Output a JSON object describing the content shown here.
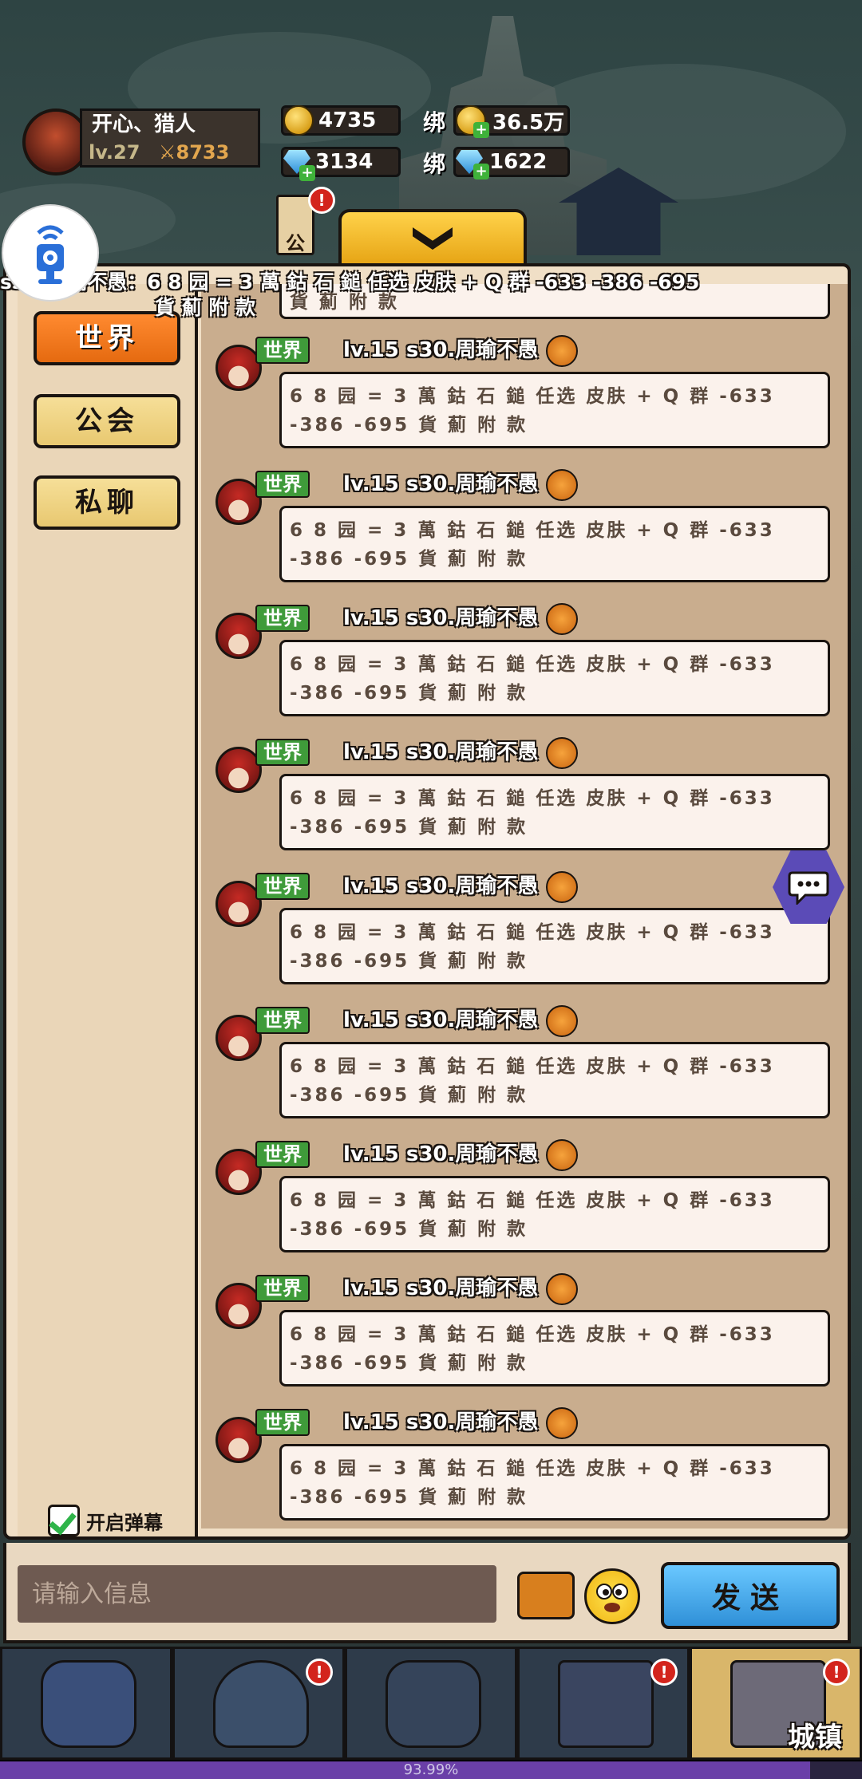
{
  "player": {
    "name": "开心、猎人",
    "level": "lv.27",
    "power": "8733"
  },
  "currency": {
    "gold": "4735",
    "gems": "3134",
    "bound_label": "绑",
    "bound_gold": "36.5万",
    "bound_gems": "1622"
  },
  "guild_tab_label": "公",
  "guild_badge": "!",
  "marquee": {
    "line1": "s30.周瑜不愚：6 8 园 = 3 萬 鈷 石 鎚 任选 皮肤 + Q 群 -633 -386 -695",
    "line2": "貨 薊 附 款"
  },
  "sidebar": {
    "tabs": [
      {
        "label": "世界",
        "active": true
      },
      {
        "label": "公会",
        "active": false
      },
      {
        "label": "私聊",
        "active": false
      }
    ],
    "barrage_label": "开启弹幕",
    "barrage_checked": true
  },
  "partial_message_text": "貨 薊 附 款",
  "messages": [
    {
      "channel": "世界",
      "sender": "lv.15  s30.周瑜不愚",
      "text": "6 8 园 = 3 萬 鈷 石 鎚 任选 皮肤 + Q 群 -633 -386 -695 貨 薊 附 款"
    },
    {
      "channel": "世界",
      "sender": "lv.15  s30.周瑜不愚",
      "text": "6 8 园 = 3 萬 鈷 石 鎚 任选 皮肤 + Q 群 -633 -386 -695 貨 薊 附 款"
    },
    {
      "channel": "世界",
      "sender": "lv.15  s30.周瑜不愚",
      "text": "6 8 园 = 3 萬 鈷 石 鎚 任选 皮肤 + Q 群 -633 -386 -695 貨 薊 附 款"
    },
    {
      "channel": "世界",
      "sender": "lv.15  s30.周瑜不愚",
      "text": "6 8 园 = 3 萬 鈷 石 鎚 任选 皮肤 + Q 群 -633 -386 -695 貨 薊 附 款"
    },
    {
      "channel": "世界",
      "sender": "lv.15  s30.周瑜不愚",
      "text": "6 8 园 = 3 萬 鈷 石 鎚 任选 皮肤 + Q 群 -633 -386 -695 貨 薊 附 款"
    },
    {
      "channel": "世界",
      "sender": "lv.15  s30.周瑜不愚",
      "text": "6 8 园 = 3 萬 鈷 石 鎚 任选 皮肤 + Q 群 -633 -386 -695 貨 薊 附 款"
    },
    {
      "channel": "世界",
      "sender": "lv.15  s30.周瑜不愚",
      "text": "6 8 园 = 3 萬 鈷 石 鎚 任选 皮肤 + Q 群 -633 -386 -695 貨 薊 附 款"
    },
    {
      "channel": "世界",
      "sender": "lv.15  s30.周瑜不愚",
      "text": "6 8 园 = 3 萬 鈷 石 鎚 任选 皮肤 + Q 群 -633 -386 -695 貨 薊 附 款"
    },
    {
      "channel": "世界",
      "sender": "lv.15  s30.周瑜不愚",
      "text": "6 8 园 = 3 萬 鈷 石 鎚 任选 皮肤 + Q 群 -633 -386 -695 貨 薊 附 款"
    }
  ],
  "input": {
    "placeholder": "请输入信息",
    "value": ""
  },
  "send_label": "发送",
  "bottom_nav": {
    "items": [
      {
        "icon": "rock-golem-icon",
        "badge": ""
      },
      {
        "icon": "hooded-monster-icon",
        "badge": "!"
      },
      {
        "icon": "skull-warrior-icon",
        "badge": ""
      },
      {
        "icon": "shrine-icon",
        "badge": "!"
      },
      {
        "icon": "castle-icon",
        "badge": "!",
        "label": "城镇",
        "active": true
      }
    ]
  },
  "progress": {
    "text": "93.99%",
    "value": 0.9399
  },
  "colors": {
    "accent_orange": "#e56a10",
    "panel_bg": "#f0dfc6",
    "chat_bg": "#c9ad8e",
    "send_blue": "#2f90d8",
    "channel_green": "#3f9b3a"
  }
}
